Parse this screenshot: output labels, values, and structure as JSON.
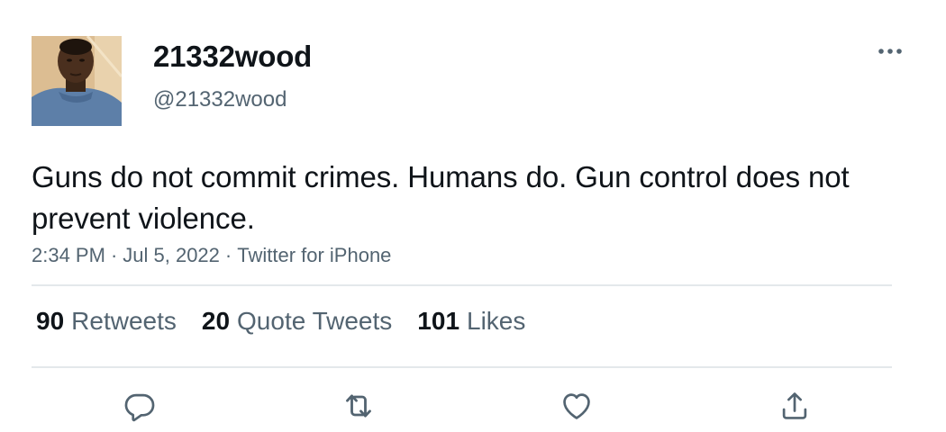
{
  "user": {
    "display_name": "21332wood",
    "handle": "@21332wood"
  },
  "tweet": {
    "text": "Guns do not commit crimes. Humans do. Gun control does not prevent violence.",
    "time": "2:34 PM",
    "date": "Jul 5, 2022",
    "source": "Twitter for iPhone",
    "separator": "·"
  },
  "stats": {
    "retweets": {
      "count": "90",
      "label": "Retweets"
    },
    "quote_tweets": {
      "count": "20",
      "label": "Quote Tweets"
    },
    "likes": {
      "count": "101",
      "label": "Likes"
    }
  },
  "icons": {
    "more": "more-horizontal-icon",
    "reply": "reply-icon",
    "retweet": "retweet-icon",
    "like": "heart-icon",
    "share": "share-icon"
  },
  "colors": {
    "text_primary": "#0f1419",
    "text_secondary": "#536471",
    "divider": "#e4e8eb",
    "icon": "#536471"
  }
}
